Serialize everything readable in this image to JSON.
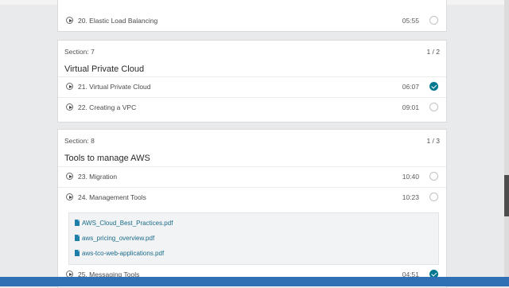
{
  "prev_section": {
    "lecture": {
      "title": "20. Elastic Load Balancing",
      "duration": "05:55",
      "completed": false
    }
  },
  "sections": [
    {
      "label": "Section: 7",
      "count": "1 / 2",
      "title": "Virtual Private Cloud",
      "lectures": [
        {
          "title": "21. Virtual Private Cloud",
          "duration": "06:07",
          "completed": true
        },
        {
          "title": "22. Creating a VPC",
          "duration": "09:01",
          "completed": false
        }
      ]
    },
    {
      "label": "Section: 8",
      "count": "1 / 3",
      "title": "Tools to manage AWS",
      "lectures": [
        {
          "title": "23. Migration",
          "duration": "10:40",
          "completed": false
        },
        {
          "title": "24. Management Tools",
          "duration": "10:23",
          "completed": false
        },
        {
          "title": "25. Messaging Tools",
          "duration": "04:51",
          "completed": true
        }
      ],
      "resources": [
        "AWS_Cloud_Best_Practices.pdf",
        "aws_pricing_overview.pdf",
        "aws-tco-web-applications.pdf"
      ]
    }
  ],
  "colors": {
    "accent": "#007791",
    "link": "#1a6b8a",
    "taskbar": "#2f6fb3"
  },
  "icons": {
    "play": "play-circle-icon",
    "check": "check-circle-icon",
    "file": "pdf-file-icon"
  }
}
